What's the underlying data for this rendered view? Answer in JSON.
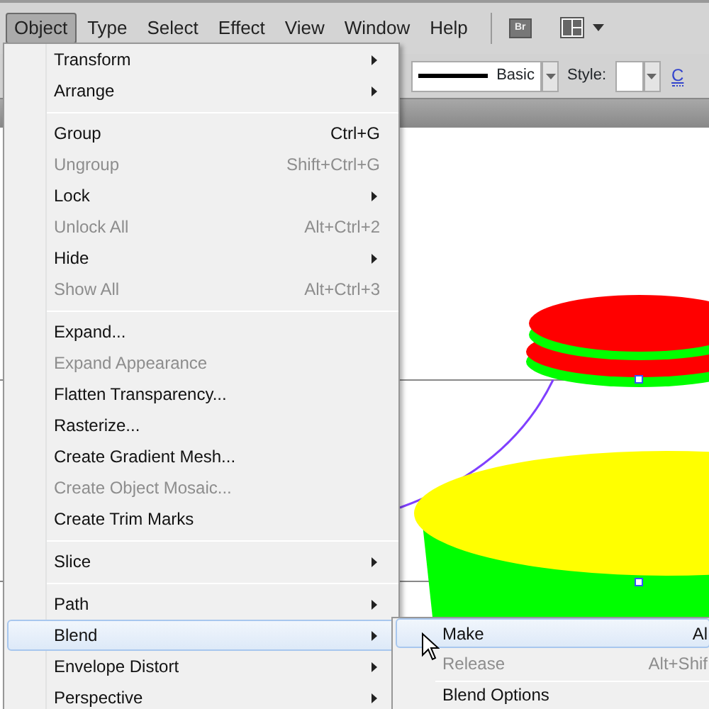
{
  "menubar": [
    {
      "label": "Object",
      "selected": true
    },
    {
      "label": "Type",
      "selected": false
    },
    {
      "label": "Select",
      "selected": false
    },
    {
      "label": "Effect",
      "selected": false
    },
    {
      "label": "View",
      "selected": false
    },
    {
      "label": "Window",
      "selected": false
    },
    {
      "label": "Help",
      "selected": false
    }
  ],
  "app_bar": {
    "bridge_label": "Br"
  },
  "control_bar": {
    "stroke_profile": "Basic",
    "style_label": "Style:",
    "link": "C"
  },
  "menu": [
    {
      "kind": "item",
      "label": "Transform",
      "submenu": true,
      "disabled": false,
      "selected": false
    },
    {
      "kind": "item",
      "label": "Arrange",
      "submenu": true,
      "disabled": false,
      "selected": false
    },
    {
      "kind": "separator"
    },
    {
      "kind": "item",
      "label": "Group",
      "shortcut": "Ctrl+G",
      "submenu": false,
      "disabled": false,
      "selected": false
    },
    {
      "kind": "item",
      "label": "Ungroup",
      "shortcut": "Shift+Ctrl+G",
      "submenu": false,
      "disabled": true,
      "selected": false
    },
    {
      "kind": "item",
      "label": "Lock",
      "submenu": true,
      "disabled": false,
      "selected": false
    },
    {
      "kind": "item",
      "label": "Unlock All",
      "shortcut": "Alt+Ctrl+2",
      "submenu": false,
      "disabled": true,
      "selected": false
    },
    {
      "kind": "item",
      "label": "Hide",
      "submenu": true,
      "disabled": false,
      "selected": false
    },
    {
      "kind": "item",
      "label": "Show All",
      "shortcut": "Alt+Ctrl+3",
      "submenu": false,
      "disabled": true,
      "selected": false
    },
    {
      "kind": "separator"
    },
    {
      "kind": "item",
      "label": "Expand...",
      "submenu": false,
      "disabled": false,
      "selected": false
    },
    {
      "kind": "item",
      "label": "Expand Appearance",
      "submenu": false,
      "disabled": true,
      "selected": false
    },
    {
      "kind": "item",
      "label": "Flatten Transparency...",
      "submenu": false,
      "disabled": false,
      "selected": false
    },
    {
      "kind": "item",
      "label": "Rasterize...",
      "submenu": false,
      "disabled": false,
      "selected": false
    },
    {
      "kind": "item",
      "label": "Create Gradient Mesh...",
      "submenu": false,
      "disabled": false,
      "selected": false
    },
    {
      "kind": "item",
      "label": "Create Object Mosaic...",
      "submenu": false,
      "disabled": true,
      "selected": false
    },
    {
      "kind": "item",
      "label": "Create Trim Marks",
      "submenu": false,
      "disabled": false,
      "selected": false
    },
    {
      "kind": "separator"
    },
    {
      "kind": "item",
      "label": "Slice",
      "submenu": true,
      "disabled": false,
      "selected": false
    },
    {
      "kind": "separator"
    },
    {
      "kind": "item",
      "label": "Path",
      "submenu": true,
      "disabled": false,
      "selected": false
    },
    {
      "kind": "item",
      "label": "Blend",
      "submenu": true,
      "disabled": false,
      "selected": true
    },
    {
      "kind": "item",
      "label": "Envelope Distort",
      "submenu": true,
      "disabled": false,
      "selected": false
    },
    {
      "kind": "item",
      "label": "Perspective",
      "submenu": true,
      "disabled": false,
      "selected": false
    }
  ],
  "submenu": [
    {
      "kind": "item",
      "label": "Make",
      "shortcut": "Al",
      "disabled": false,
      "selected": true
    },
    {
      "kind": "item",
      "label": "Release",
      "shortcut": "Alt+Shif",
      "disabled": true,
      "selected": false
    },
    {
      "kind": "separator"
    },
    {
      "kind": "item",
      "label": "Blend Options",
      "disabled": false,
      "selected": false
    }
  ]
}
